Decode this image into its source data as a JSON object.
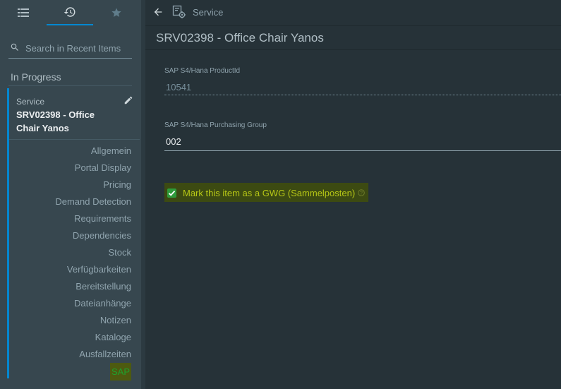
{
  "sidebar": {
    "tabs": [
      {
        "name": "list-icon"
      },
      {
        "name": "history-icon",
        "active": true
      },
      {
        "name": "star-icon"
      }
    ],
    "search_placeholder": "Search in Recent Items",
    "section_title": "In Progress",
    "item": {
      "type": "Service",
      "title": "SRV02398 - Office Chair Yanos"
    },
    "nav": [
      "Allgemein",
      "Portal Display",
      "Pricing",
      "Demand Detection",
      "Requirements",
      "Dependencies",
      "Stock",
      "Verfügbarkeiten",
      "Bereitstellung",
      "Dateianhänge",
      "Notizen",
      "Kataloge",
      "Ausfallzeiten",
      "SAP"
    ]
  },
  "topbar": {
    "label": "Service"
  },
  "main": {
    "title": "SRV02398 - Office Chair Yanos",
    "fields": [
      {
        "label": "SAP S4/Hana ProductId",
        "value": "10541"
      },
      {
        "label": "SAP S4/Hana Purchasing Group",
        "value": "002"
      }
    ],
    "gwg": {
      "label": "Mark this item as a GWG (Sammelposten)",
      "checked": true
    }
  },
  "colors": {
    "accent": "#0288d1",
    "highlight": "#4d5a10",
    "check": "#2e9b3a"
  }
}
